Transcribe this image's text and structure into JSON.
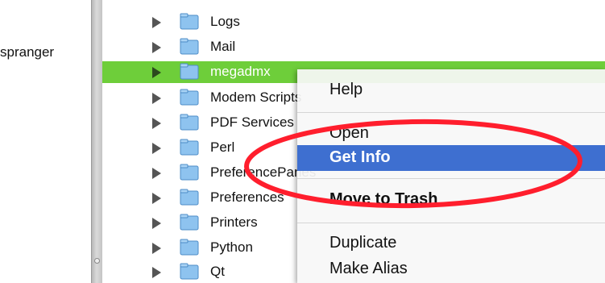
{
  "user_label": "spranger",
  "folders": [
    {
      "name": "Logs"
    },
    {
      "name": "Mail"
    },
    {
      "name": "megadmx",
      "selected": true
    },
    {
      "name": "Modem Scripts"
    },
    {
      "name": "PDF Services"
    },
    {
      "name": "Perl"
    },
    {
      "name": "PreferencePanes"
    },
    {
      "name": "Preferences"
    },
    {
      "name": "Printers"
    },
    {
      "name": "Python"
    },
    {
      "name": "Qt"
    }
  ],
  "context_menu": {
    "items": [
      {
        "label": "Help"
      },
      {
        "label": "Open"
      },
      {
        "label": "Get Info",
        "highlighted": true
      },
      {
        "label": "Move to Trash"
      },
      {
        "label": "Duplicate"
      },
      {
        "label": "Make Alias"
      }
    ]
  },
  "colors": {
    "selection": "#6ece3a",
    "menu_highlight": "#3e6fd0",
    "annotation": "#ff1e2d"
  }
}
